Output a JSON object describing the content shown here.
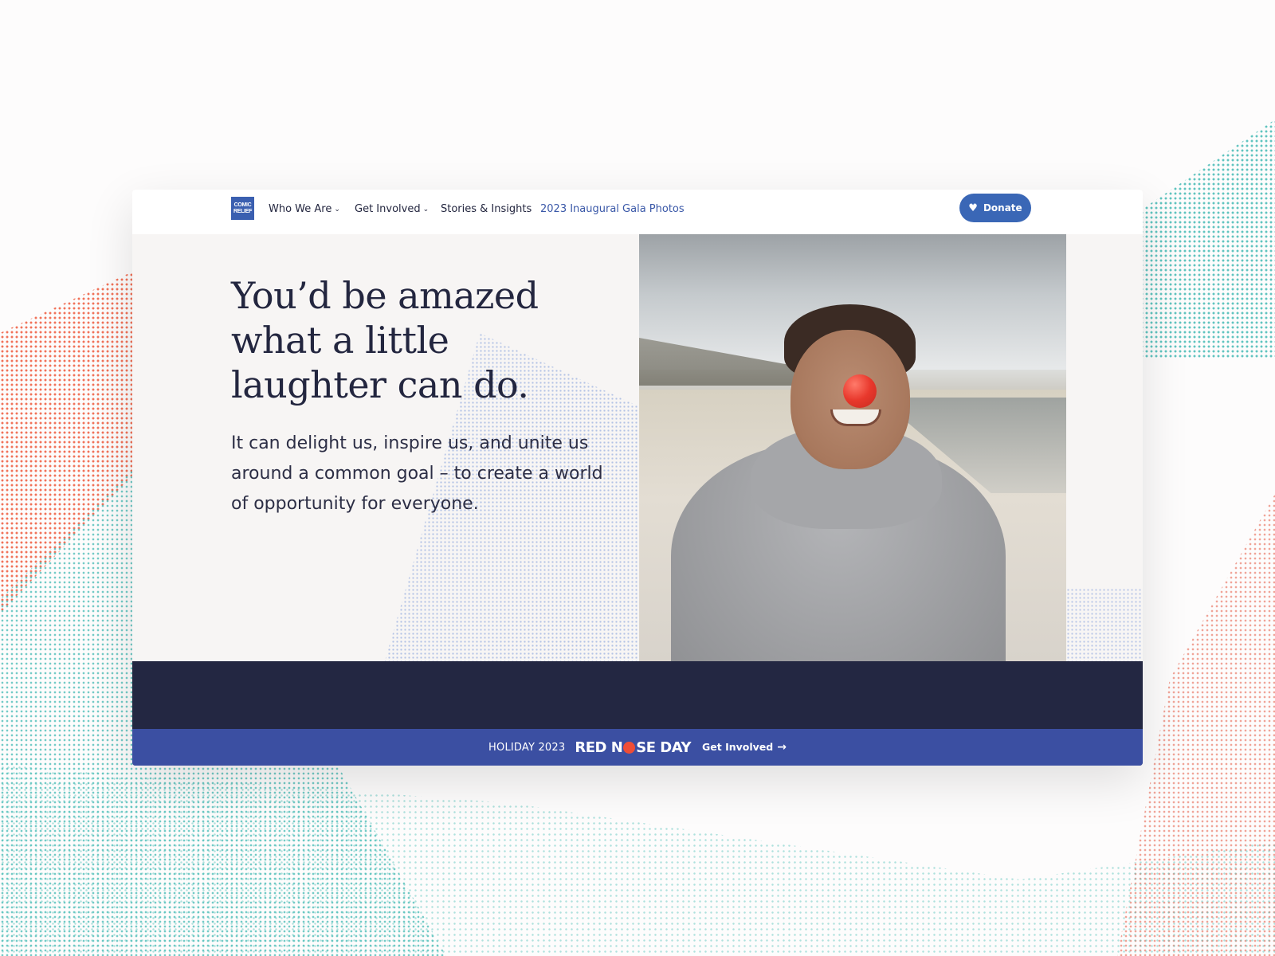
{
  "nav": {
    "logo_text": [
      "COMIC",
      "RELIEF"
    ],
    "items": [
      {
        "label": "Who We Are",
        "has_dropdown": true
      },
      {
        "label": "Get Involved",
        "has_dropdown": true
      },
      {
        "label": "Stories & Insights",
        "has_dropdown": false
      },
      {
        "label": "2023 Inaugural Gala Photos",
        "has_dropdown": false,
        "accent": true
      }
    ],
    "donate_label": "Donate",
    "donate_icon": "heart-icon"
  },
  "hero": {
    "headline": "You’d be amazed what a little laughter can do.",
    "subtext": "It can delight us, inspire us, and unite us around a common goal – to create a world of opportunity for everyone."
  },
  "banner": {
    "holiday_label": "HOLIDAY 2023",
    "logo_before": "RED N",
    "logo_after": "SE DAY",
    "link_label": "Get Involved",
    "link_icon": "arrow-right-icon"
  },
  "colors": {
    "brand_blue": "#3a67b6",
    "navy": "#232742",
    "banner_blue": "#3b4fa2",
    "nose_red": "#ef4d36",
    "text_dark": "#23263f"
  }
}
